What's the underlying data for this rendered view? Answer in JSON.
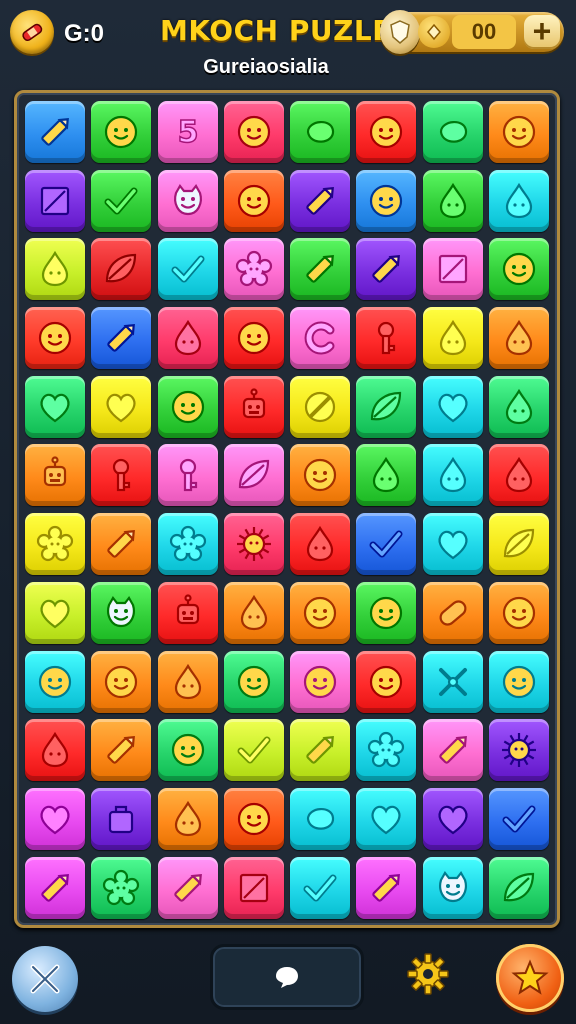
{
  "header": {
    "score": "G:0",
    "title": "MKOCH PUZLE",
    "subtitle": "Gureiaosialia",
    "currency_amount": "00",
    "plus_label": "+"
  },
  "board": {
    "rows": [
      [
        {
          "c": "#2e8ff0",
          "i": "pencil"
        },
        {
          "c": "#33d03a",
          "i": "smile"
        },
        {
          "c": "#ff6fd2",
          "i": "five"
        },
        {
          "c": "#ff3b6b",
          "i": "smile"
        },
        {
          "c": "#33d03a",
          "i": "blob"
        },
        {
          "c": "#ff2a2a",
          "i": "smile"
        },
        {
          "c": "#27d46b",
          "i": "blob"
        },
        {
          "c": "#ff8a1a",
          "i": "smile"
        }
      ],
      [
        {
          "c": "#7a2fe0",
          "i": "square"
        },
        {
          "c": "#33d03a",
          "i": "check"
        },
        {
          "c": "#ff6fd2",
          "i": "cat"
        },
        {
          "c": "#ff5a1a",
          "i": "smile"
        },
        {
          "c": "#7a2fe0",
          "i": "pencil"
        },
        {
          "c": "#2e8ff0",
          "i": "smile"
        },
        {
          "c": "#33d03a",
          "i": "drop"
        },
        {
          "c": "#1fd6e8",
          "i": "drop"
        }
      ],
      [
        {
          "c": "#c8f02a",
          "i": "drop"
        },
        {
          "c": "#e8282a",
          "i": "leaf"
        },
        {
          "c": "#1fd6e8",
          "i": "check"
        },
        {
          "c": "#ff6fd2",
          "i": "flower"
        },
        {
          "c": "#33d03a",
          "i": "pencil"
        },
        {
          "c": "#7a2fe0",
          "i": "pencil"
        },
        {
          "c": "#ff6fd2",
          "i": "square"
        },
        {
          "c": "#33d03a",
          "i": "smile"
        }
      ],
      [
        {
          "c": "#ff3b2a",
          "i": "smile"
        },
        {
          "c": "#2e6ff0",
          "i": "pencil"
        },
        {
          "c": "#ff3b6b",
          "i": "drop"
        },
        {
          "c": "#ff2a2a",
          "i": "smile"
        },
        {
          "c": "#ff6fd2",
          "i": "ring"
        },
        {
          "c": "#ff2a2a",
          "i": "key"
        },
        {
          "c": "#f5e81a",
          "i": "drop"
        },
        {
          "c": "#ff8a1a",
          "i": "drop"
        }
      ],
      [
        {
          "c": "#27d46b",
          "i": "heart"
        },
        {
          "c": "#f5e81a",
          "i": "heart"
        },
        {
          "c": "#33d03a",
          "i": "smile"
        },
        {
          "c": "#ff2a2a",
          "i": "robot"
        },
        {
          "c": "#f5e81a",
          "i": "ban"
        },
        {
          "c": "#27d46b",
          "i": "leaf"
        },
        {
          "c": "#1fd6e8",
          "i": "heart"
        },
        {
          "c": "#27d46b",
          "i": "drop"
        }
      ],
      [
        {
          "c": "#ff8a1a",
          "i": "robot"
        },
        {
          "c": "#ff2a2a",
          "i": "key"
        },
        {
          "c": "#ff6fd2",
          "i": "key"
        },
        {
          "c": "#ff6fd2",
          "i": "leaf"
        },
        {
          "c": "#ff8a1a",
          "i": "smile"
        },
        {
          "c": "#33d03a",
          "i": "drop"
        },
        {
          "c": "#1fd6e8",
          "i": "drop"
        },
        {
          "c": "#ff2a2a",
          "i": "drop"
        }
      ],
      [
        {
          "c": "#f5e81a",
          "i": "flower"
        },
        {
          "c": "#ff8a1a",
          "i": "pencil"
        },
        {
          "c": "#1fd6e8",
          "i": "flower"
        },
        {
          "c": "#ff3b6b",
          "i": "sun"
        },
        {
          "c": "#ff2a2a",
          "i": "drop"
        },
        {
          "c": "#2e6ff0",
          "i": "check"
        },
        {
          "c": "#1fd6e8",
          "i": "heart"
        },
        {
          "c": "#f5e81a",
          "i": "leaf"
        }
      ],
      [
        {
          "c": "#c8f02a",
          "i": "heart"
        },
        {
          "c": "#33d03a",
          "i": "cat"
        },
        {
          "c": "#ff2a2a",
          "i": "robot"
        },
        {
          "c": "#ff8a1a",
          "i": "drop"
        },
        {
          "c": "#ff8a1a",
          "i": "smile"
        },
        {
          "c": "#33d03a",
          "i": "smile"
        },
        {
          "c": "#ff8a1a",
          "i": "pill"
        },
        {
          "c": "#ff8a1a",
          "i": "smile"
        }
      ],
      [
        {
          "c": "#1fd6e8",
          "i": "smile"
        },
        {
          "c": "#ff8a1a",
          "i": "smile"
        },
        {
          "c": "#ff8a1a",
          "i": "drop"
        },
        {
          "c": "#27d46b",
          "i": "smile"
        },
        {
          "c": "#ff6fd2",
          "i": "smile"
        },
        {
          "c": "#ff2a2a",
          "i": "smile"
        },
        {
          "c": "#1fd6e8",
          "i": "cross"
        },
        {
          "c": "#1fd6e8",
          "i": "smile"
        }
      ],
      [
        {
          "c": "#ff2a2a",
          "i": "drop"
        },
        {
          "c": "#ff8a1a",
          "i": "pencil"
        },
        {
          "c": "#27d46b",
          "i": "smile"
        },
        {
          "c": "#c8f02a",
          "i": "check"
        },
        {
          "c": "#c8f02a",
          "i": "pencil"
        },
        {
          "c": "#1fd6e8",
          "i": "flower"
        },
        {
          "c": "#ff6fd2",
          "i": "pencil"
        },
        {
          "c": "#7a2fe0",
          "i": "sun"
        }
      ],
      [
        {
          "c": "#e84af0",
          "i": "heart"
        },
        {
          "c": "#7a2fe0",
          "i": "bag"
        },
        {
          "c": "#ff8a1a",
          "i": "drop"
        },
        {
          "c": "#ff5a1a",
          "i": "smile"
        },
        {
          "c": "#1fd6e8",
          "i": "blob"
        },
        {
          "c": "#1fd6e8",
          "i": "heart"
        },
        {
          "c": "#7a2fe0",
          "i": "heart"
        },
        {
          "c": "#2e6ff0",
          "i": "check"
        }
      ],
      [
        {
          "c": "#e84af0",
          "i": "pencil"
        },
        {
          "c": "#27d46b",
          "i": "flower"
        },
        {
          "c": "#ff6fd2",
          "i": "pencil"
        },
        {
          "c": "#ff3b6b",
          "i": "square"
        },
        {
          "c": "#1fd6e8",
          "i": "check"
        },
        {
          "c": "#e84af0",
          "i": "pencil"
        },
        {
          "c": "#1fd6e8",
          "i": "cat"
        },
        {
          "c": "#27d46b",
          "i": "leaf"
        }
      ]
    ]
  },
  "bottom": {
    "left_icon": "crossed-swords-icon",
    "center_icon": "speech-bubble-icon",
    "settings_icon": "gear-icon",
    "right_icon": "star-icon"
  }
}
